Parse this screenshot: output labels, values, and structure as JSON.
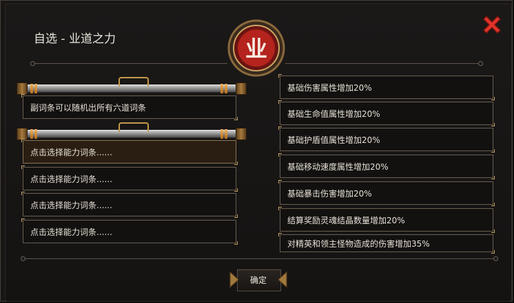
{
  "title": "自选 - 业道之力",
  "emblem_char": "业",
  "description": "副词条可以随机出所有六道词条",
  "slots": [
    "点击选择能力词条......",
    "点击选择能力词条......",
    "点击选择能力词条......",
    "点击选择能力词条......"
  ],
  "options": [
    "基础伤害属性增加20%",
    "基础生命值属性增加20%",
    "基础护盾值属性增加20%",
    "基础移动速度属性增加20%",
    "基础暴击伤害增加20%",
    "结算奖励灵魂结晶数量增加20%",
    "对精英和领主怪物造成的伤害增加35%"
  ],
  "confirm_label": "确定",
  "colors": {
    "close": "#e0342a",
    "emblem_red": "#b5231d",
    "gold": "#c9a867"
  }
}
